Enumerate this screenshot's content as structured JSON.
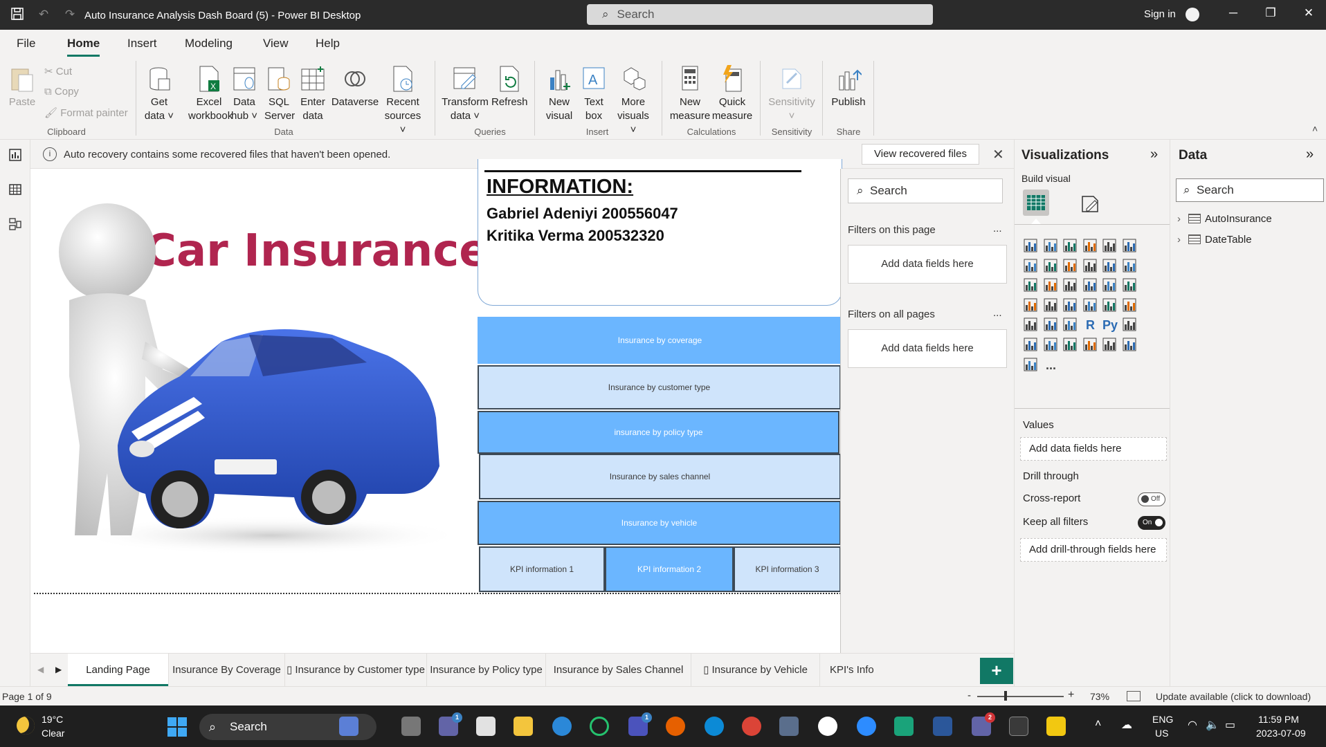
{
  "window": {
    "title": "Auto Insurance Analysis Dash Board (5) - Power BI Desktop",
    "search_placeholder": "Search",
    "sign_in": "Sign in"
  },
  "menu": {
    "tabs": [
      "File",
      "Home",
      "Insert",
      "Modeling",
      "View",
      "Help"
    ],
    "active": "Home"
  },
  "ribbon": {
    "clipboard": {
      "paste": "Paste",
      "cut": "Cut",
      "copy": "Copy",
      "format_painter": "Format painter",
      "label": "Clipboard"
    },
    "data": {
      "get_data": [
        "Get",
        "data"
      ],
      "excel": [
        "Excel",
        "workbook"
      ],
      "data_hub": [
        "Data",
        "hub"
      ],
      "sql": [
        "SQL",
        "Server"
      ],
      "enter": [
        "Enter",
        "data"
      ],
      "dataverse": "Dataverse",
      "recent": [
        "Recent",
        "sources"
      ],
      "label": "Data"
    },
    "queries": {
      "transform": [
        "Transform",
        "data"
      ],
      "refresh": "Refresh",
      "label": "Queries"
    },
    "insert": {
      "new_visual": [
        "New",
        "visual"
      ],
      "text_box": [
        "Text",
        "box"
      ],
      "more_visuals": [
        "More",
        "visuals"
      ],
      "label": "Insert"
    },
    "calculations": {
      "new_measure": [
        "New",
        "measure"
      ],
      "quick_measure": [
        "Quick",
        "measure"
      ],
      "label": "Calculations"
    },
    "sensitivity": {
      "sensitivity": "Sensitivity",
      "label": "Sensitivity"
    },
    "share": {
      "publish": "Publish",
      "label": "Share"
    }
  },
  "recovery": {
    "message": "Auto recovery contains some recovered files that haven't been opened.",
    "button": "View recovered files"
  },
  "canvas": {
    "image_text": "Car Insurance",
    "info_heading": "INFORMATION:",
    "names": [
      "Gabriel Adeniyi 200556047",
      "Kritika Verma 200532320"
    ],
    "nav_buttons": [
      "Insurance by coverage",
      "Insurance by customer type",
      "insurance by policy type",
      "Insurance by sales channel",
      "Insurance by vehicle"
    ],
    "kpi_buttons": [
      "KPI information 1",
      "KPI information 2",
      "KPI information 3"
    ]
  },
  "filters": {
    "search": "Search",
    "on_this_page": "Filters on this page",
    "on_all_pages": "Filters on all pages",
    "add_fields": "Add data fields here",
    "more": "..."
  },
  "visualizations": {
    "title": "Visualizations",
    "build_visual": "Build visual",
    "values": "Values",
    "values_drop": "Add data fields here",
    "drill_through": "Drill through",
    "cross_report": "Cross-report",
    "cross_report_state": "Off",
    "keep_all_filters": "Keep all filters",
    "keep_all_filters_state": "On",
    "drill_drop": "Add drill-through fields here",
    "r_label": "R",
    "py_label": "Py",
    "more": "..."
  },
  "data_pane": {
    "title": "Data",
    "search": "Search",
    "tables": [
      "AutoInsurance",
      "DateTable"
    ]
  },
  "page_tabs": {
    "tabs": [
      "Landing Page",
      "Insurance By Coverage",
      "▯ Insurance by Customer type",
      "Insurance by Policy type",
      "Insurance by Sales Channel",
      "▯ Insurance by Vehicle",
      "KPI's Info"
    ],
    "active": "Landing Page",
    "add": "+"
  },
  "status": {
    "page": "Page 1 of 9",
    "zoom": "73%",
    "zoom_value": 73,
    "update": "Update available (click to download)",
    "minus": "-",
    "plus": "+"
  },
  "taskbar": {
    "temp": "19°C",
    "weather": "Clear",
    "search": "Search",
    "lang1": "ENG",
    "lang2": "US",
    "time": "11:59 PM",
    "date": "2023-07-09",
    "badges": {
      "teams_chat": "1",
      "teams_work": "1",
      "teams": "2"
    }
  },
  "colors": {
    "accent": "#117865",
    "nav_dark": "#6bb6ff",
    "nav_light": "#cfe4fb",
    "car_blue": "#2f56c8",
    "title_text": "#b0254f"
  }
}
